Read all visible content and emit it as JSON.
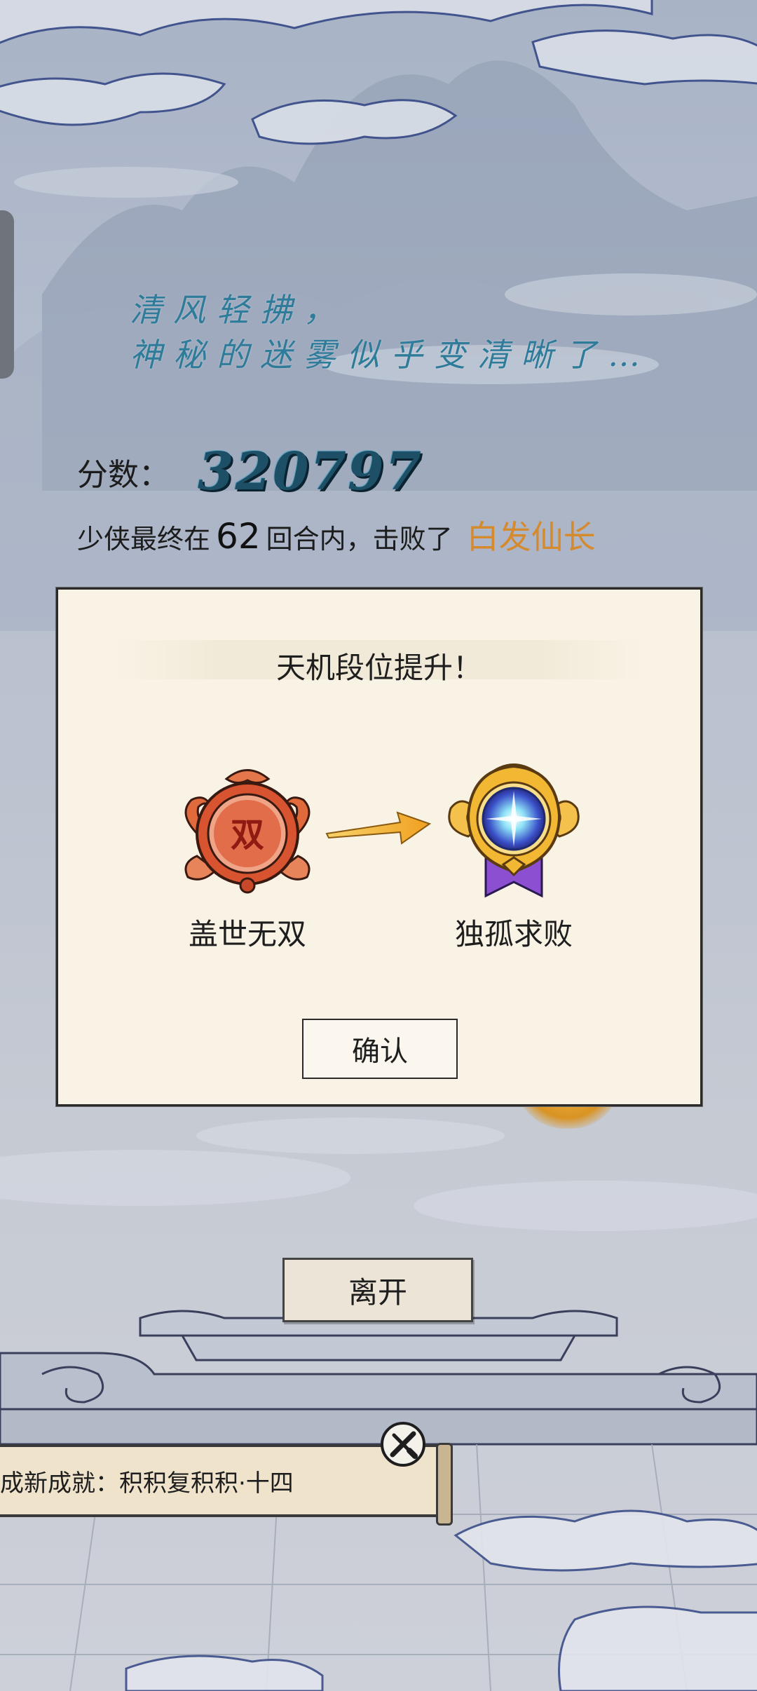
{
  "poem": {
    "line1": "清风轻拂，",
    "line2": "神秘的迷雾似乎变清晰了…"
  },
  "score": {
    "label": "分数：",
    "value": "320797"
  },
  "result": {
    "prefix": "少侠最终在",
    "rounds": "62",
    "middle": "回合内，击败了",
    "boss": "白发仙长"
  },
  "dialog": {
    "title": "天机段位提升！",
    "old_rank": {
      "name": "盖世无双",
      "badge_char": "双",
      "icon": "red-rank-badge-icon"
    },
    "new_rank": {
      "name": "独孤求败",
      "icon": "gold-crystal-rank-badge-icon"
    },
    "confirm_label": "确认"
  },
  "leave_label": "离开",
  "achievement": {
    "text": "成新成就：积积复积积·十四",
    "icon": "crossed-swords-icon"
  },
  "colors": {
    "poem": "#2f7c9a",
    "score": "#1d4f66",
    "boss": "#d58a2e",
    "dialog_bg": "#f9f3e6"
  }
}
